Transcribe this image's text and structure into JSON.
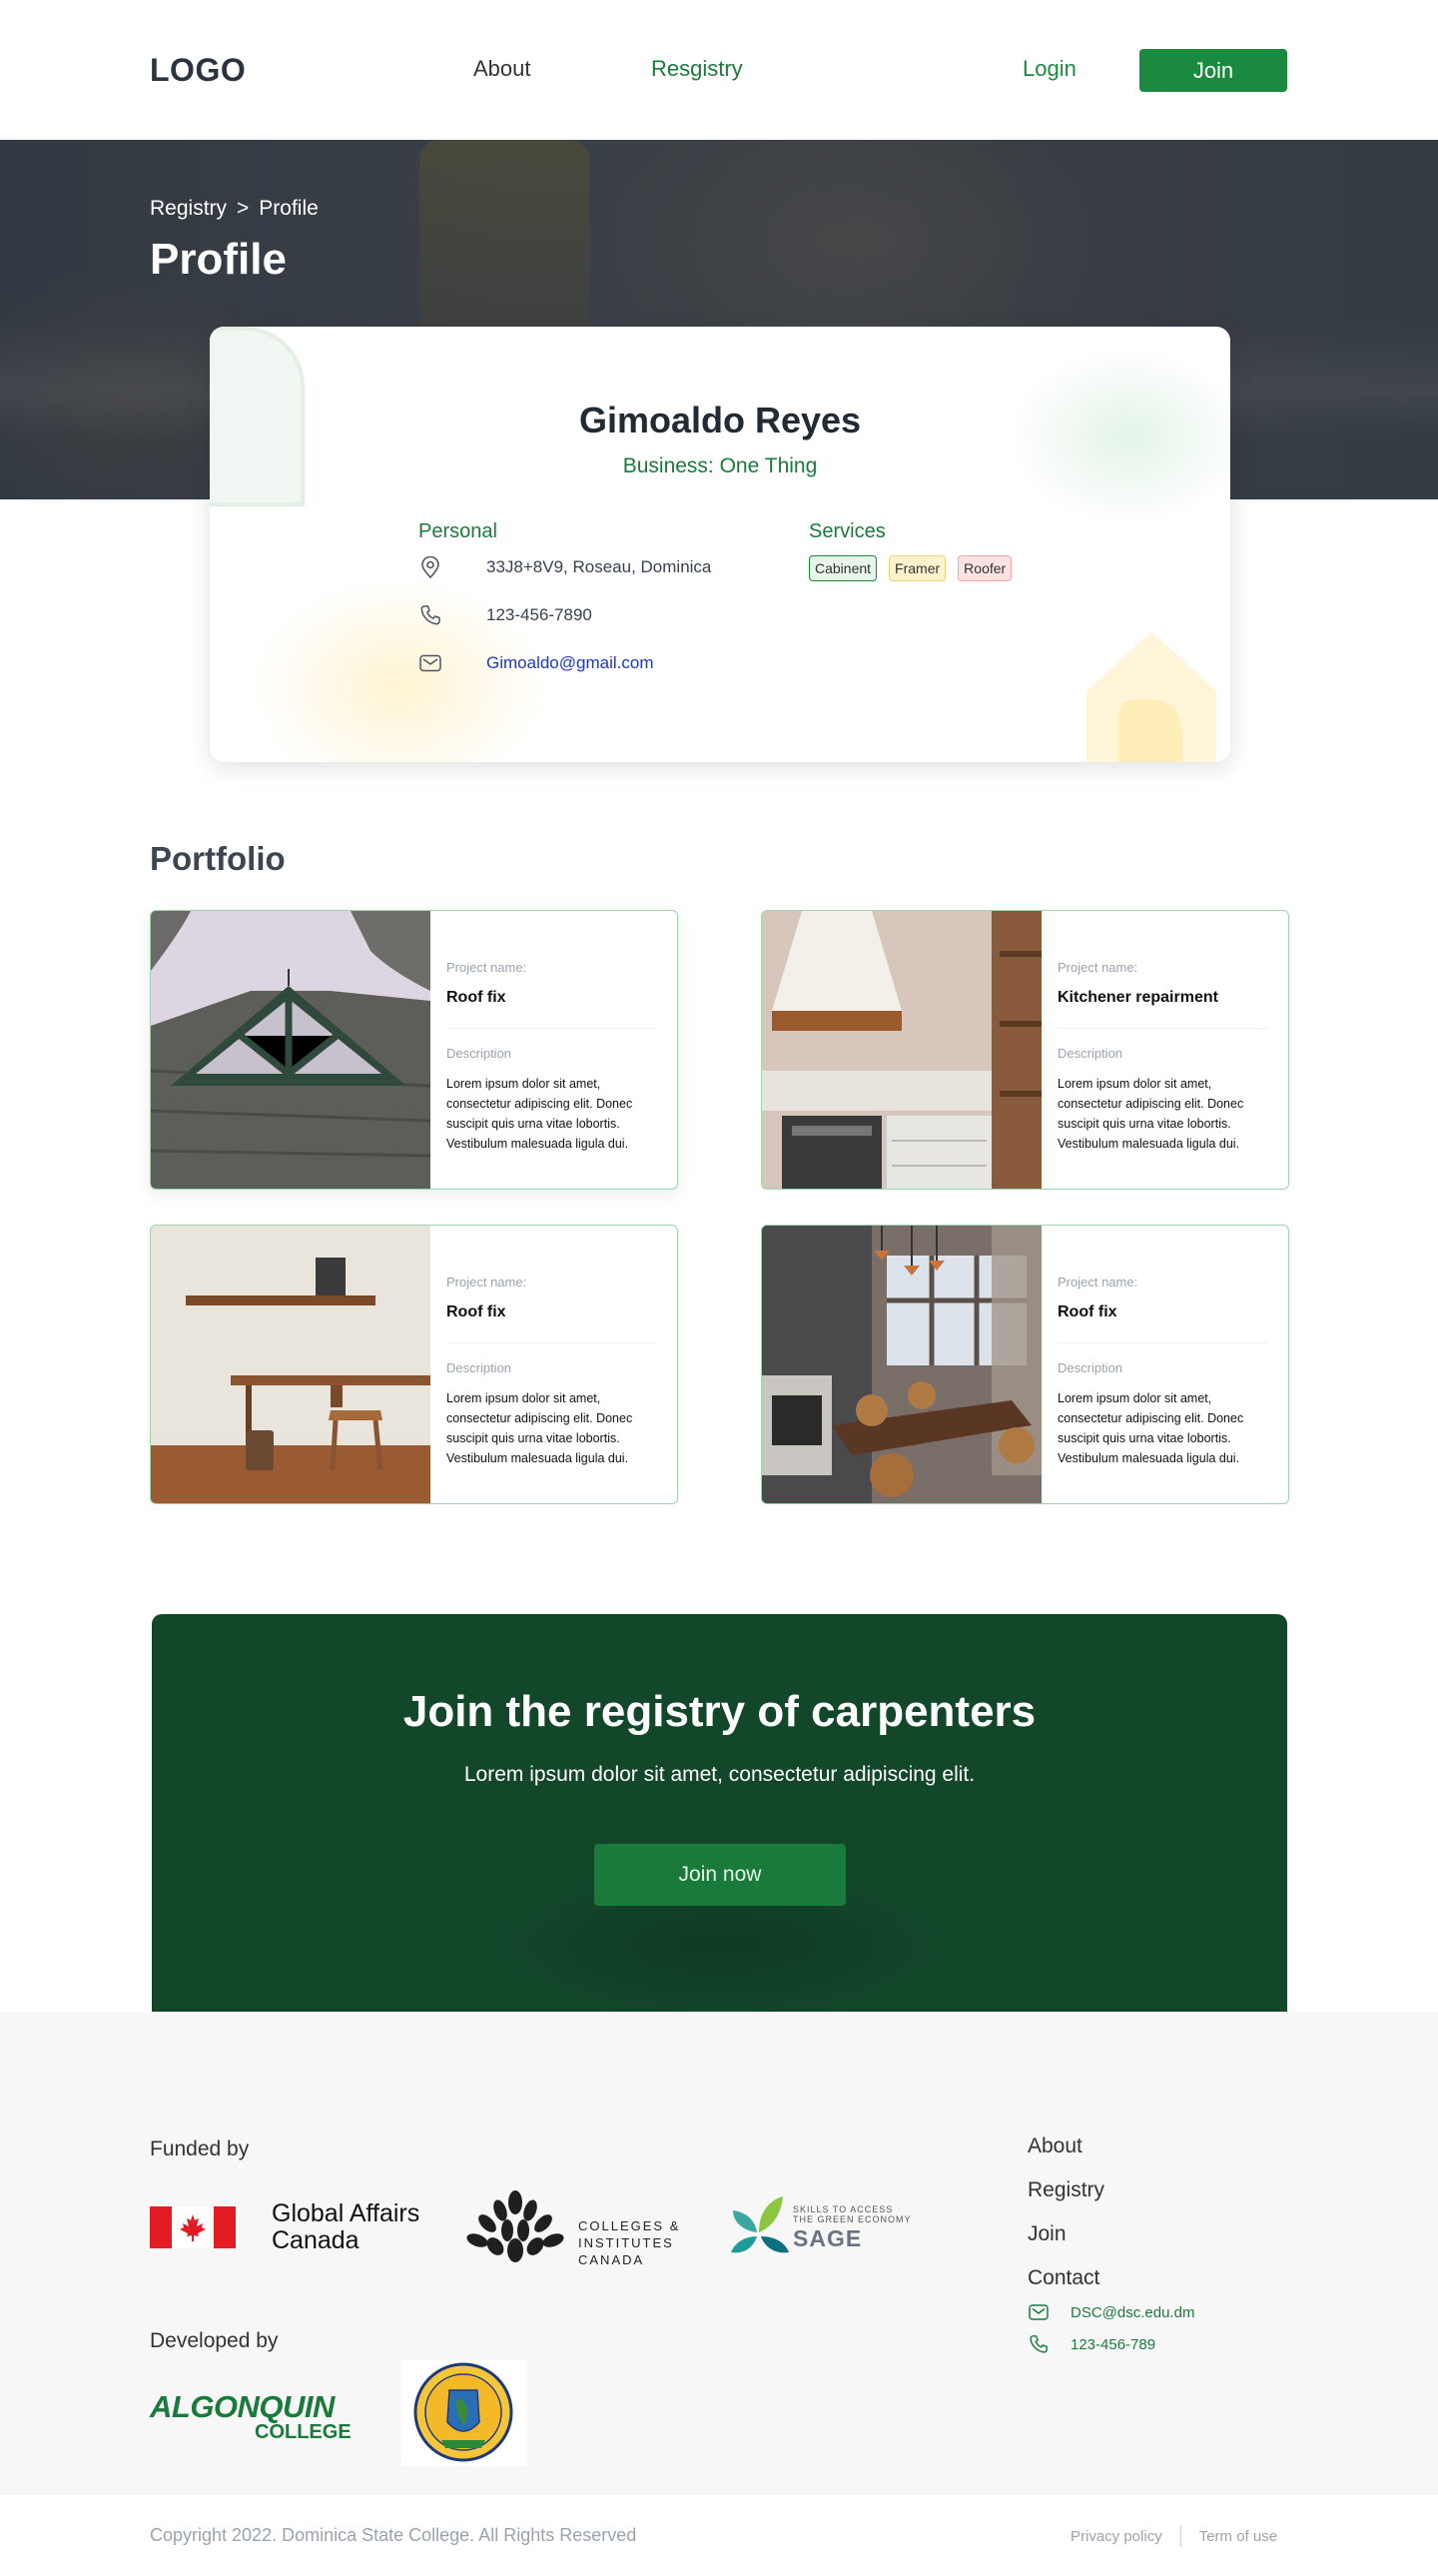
{
  "header": {
    "logo": "LOGO",
    "nav": {
      "about": "About",
      "registry": "Resgistry"
    },
    "login": "Login",
    "join": "Join"
  },
  "hero": {
    "breadcrumb": {
      "parent": "Registry",
      "separator": ">",
      "current": "Profile"
    },
    "title": "Profile"
  },
  "profile": {
    "name": "Gimoaldo Reyes",
    "business": "Business: One Thing",
    "personal_heading": "Personal",
    "address": "33J8+8V9, Roseau, Dominica",
    "phone": "123-456-7890",
    "email": "Gimoaldo@gmail.com",
    "services_heading": "Services",
    "services": [
      "Cabinent",
      "Framer",
      "Roofer"
    ]
  },
  "portfolio": {
    "title": "Portfolio",
    "project_label": "Project name:",
    "description_label": "Description",
    "items": [
      {
        "name": "Roof fix",
        "description": "Lorem ipsum dolor sit amet, consectetur adipiscing elit. Donec suscipit quis urna vitae lobortis. Vestibulum malesuada ligula dui."
      },
      {
        "name": "Kitchener repairment",
        "description": "Lorem ipsum dolor sit amet, consectetur adipiscing elit. Donec suscipit quis urna vitae lobortis. Vestibulum malesuada ligula dui."
      },
      {
        "name": "Roof fix",
        "description": "Lorem ipsum dolor sit amet, consectetur adipiscing elit. Donec suscipit quis urna vitae lobortis. Vestibulum malesuada ligula dui."
      },
      {
        "name": "Roof fix",
        "description": "Lorem ipsum dolor sit amet, consectetur adipiscing elit. Donec suscipit quis urna vitae lobortis. Vestibulum malesuada ligula dui."
      }
    ]
  },
  "cta": {
    "title": "Join the registry of carpenters",
    "subtitle": "Lorem ipsum dolor sit amet, consectetur adipiscing elit.",
    "button": "Join now"
  },
  "footer": {
    "funded_by": "Funded by",
    "developed_by": "Developed by",
    "gac_line1": "Global Affairs",
    "gac_line2": "Canada",
    "cic_line1": "COLLEGES &",
    "cic_line2": "INSTITUTES",
    "cic_line3": "CANADA",
    "sage_line1": "SKILLS TO ACCESS",
    "sage_line2": "THE GREEN ECONOMY",
    "sage_name": "SAGE",
    "algonquin_line1": "ALGONQUIN",
    "algonquin_line2": "COLLEGE",
    "links": {
      "about": "About",
      "registry": "Registry",
      "join": "Join",
      "contact": "Contact"
    },
    "contact_email": "DSC@dsc.edu.dm",
    "contact_phone": "123-456-789",
    "copyright": "Copyright  2022. Dominica State College. All Rights Reserved",
    "privacy": "Privacy policy",
    "terms": "Term of use"
  },
  "colors": {
    "brand_green": "#1a8a3f",
    "cta_bg": "#12472a",
    "footer_bg": "#f7f7f7"
  }
}
